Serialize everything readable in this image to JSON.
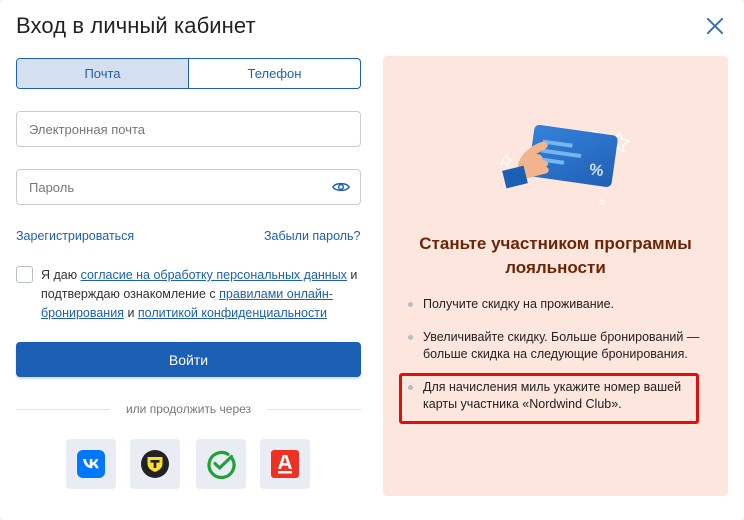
{
  "dialog": {
    "title": "Вход в личный кабинет"
  },
  "tabs": [
    {
      "label": "Почта",
      "active": true
    },
    {
      "label": "Телефон",
      "active": false
    }
  ],
  "email_field": {
    "placeholder": "Электронная почта",
    "value": ""
  },
  "password_field": {
    "placeholder": "Пароль",
    "value": ""
  },
  "links": {
    "register": "Зарегистрироваться",
    "forgot": "Забыли пароль?"
  },
  "consent": {
    "checked": false,
    "part1": "Я даю ",
    "link1": "согласие на обработку персональных данных",
    "part2": " и подтверждаю ознакомление с ",
    "link2": "правилами онлайн-бронирования",
    "part3": " и ",
    "link3": "политикой конфиденциальности"
  },
  "login_button": "Войти",
  "social": {
    "or_text": "или продолжить через",
    "providers": [
      "vk-icon",
      "tinkoff-icon",
      "sber-icon",
      "alfa-icon"
    ]
  },
  "promo": {
    "title": "Станьте участником программы лояльности",
    "card_symbol": "%",
    "bullets": [
      "Получите скидку на проживание.",
      "Увеличивайте скидку. Больше бронирований — больше скидка на следующие бронирования.",
      "Для начисления миль укажите номер вашей карты участника «Nordwind Club»."
    ]
  },
  "colors": {
    "accent": "#1b5fb4",
    "promo_bg": "#fce6dd",
    "promo_title": "#6b2608",
    "highlight": "#e10e0e"
  }
}
